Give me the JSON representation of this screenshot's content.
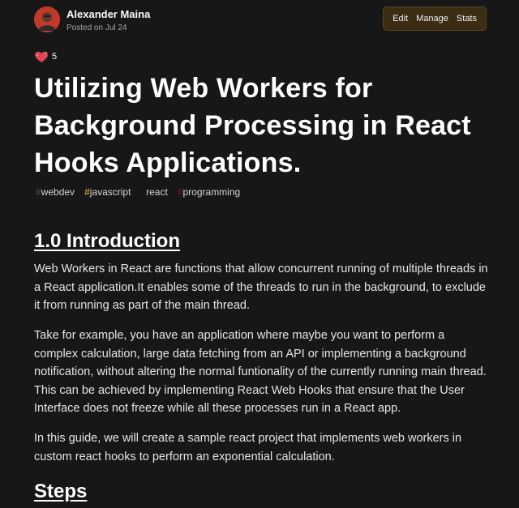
{
  "author": {
    "name": "Alexander Maina",
    "posted": "Posted on Jul 24"
  },
  "actions": {
    "edit": "Edit",
    "manage": "Manage",
    "stats": "Stats"
  },
  "reactions": {
    "count": "5"
  },
  "article": {
    "title": "Utilizing Web Workers for Background Processing in React Hooks Applications.",
    "tags": [
      {
        "hash": "#",
        "name": "webdev"
      },
      {
        "hash": "#",
        "name": "javascript"
      },
      {
        "hash": "#",
        "name": "react"
      },
      {
        "hash": "#",
        "name": "programming"
      }
    ],
    "sections": [
      {
        "heading": "1.0 Introduction"
      },
      {
        "heading": "Steps"
      }
    ],
    "paragraphs": [
      "Web Workers in React are functions that allow concurrent running of multiple threads in a React application.It enables some of the threads to run in the background, to exclude it from running as part of the main thread.",
      "Take for example, you have an application where maybe you want to perform a complex calculation, large data fetching from an API or implementing a background notification, without altering the normal funtionality of the currently running main thread. This can be achieved by implementing React Web Hooks that ensure that the User Interface does not freeze while all these processes run in a React app.",
      "In this guide, we will create a sample react project that implements web workers in custom react hooks to perform an exponential calculation."
    ]
  },
  "colors": {
    "background": "#171717",
    "actions_bg": "#3b2c14",
    "tag_javascript": "#e5c937",
    "tag_programming": "#7a1f1f"
  }
}
